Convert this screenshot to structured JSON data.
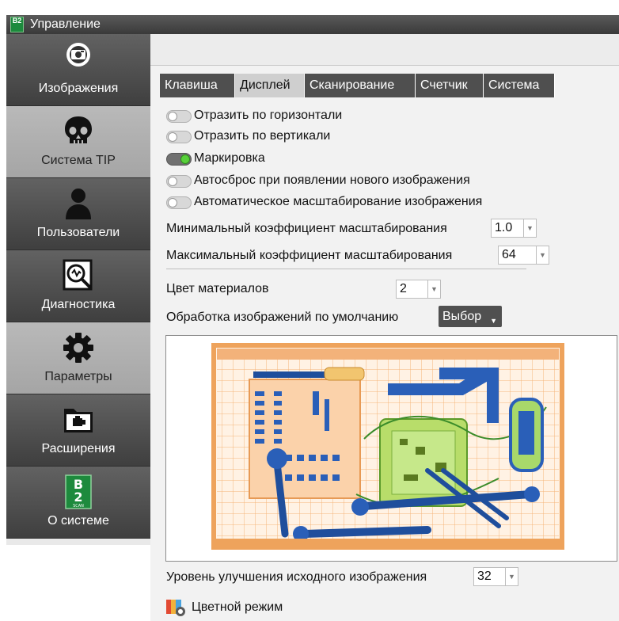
{
  "window": {
    "title": "Управление",
    "logo_text": "B2"
  },
  "sidebar": {
    "items": [
      {
        "label": "Изображения",
        "icon": "camera-icon"
      },
      {
        "label": "Система TIP",
        "icon": "skull-icon"
      },
      {
        "label": "Пользователи",
        "icon": "user-icon"
      },
      {
        "label": "Диагностика",
        "icon": "diagnostics-icon"
      },
      {
        "label": "Параметры",
        "icon": "gear-icon"
      },
      {
        "label": "Расширения",
        "icon": "folder-plugin-icon"
      },
      {
        "label": "О системе",
        "icon": "b2-scan-logo"
      }
    ],
    "logo_text": "B2",
    "logo_subtext": "SCAN"
  },
  "tabs": [
    {
      "label": "Клавиша"
    },
    {
      "label": "Дисплей"
    },
    {
      "label": "Сканирование"
    },
    {
      "label": "Счетчик"
    },
    {
      "label": "Система"
    }
  ],
  "active_tab": "Дисплей",
  "options": [
    {
      "label": "Отразить по горизонтали",
      "on": false
    },
    {
      "label": "Отразить по вертикали",
      "on": false
    },
    {
      "label": "Маркировка",
      "on": true
    },
    {
      "label": "Автосброс при появлении нового изображения",
      "on": false
    },
    {
      "label": "Автоматическое масштабирование изображения",
      "on": false
    }
  ],
  "min_scale": {
    "label": "Минимальный коэффициент масштабирования",
    "value": "1.0"
  },
  "max_scale": {
    "label": "Максимальный коэффициент масштабирования",
    "value": "64"
  },
  "material_color": {
    "label": "Цвет материалов",
    "value": "2"
  },
  "default_processing": {
    "label": "Обработка изображений по умолчанию",
    "button": "Выбор"
  },
  "enhancement": {
    "label": "Уровень улучшения исходного изображения",
    "value": "32"
  },
  "color_mode": {
    "label": "Цветной режим"
  },
  "colors": {
    "accent_green": "#58d13a",
    "nav_dark": "#4a4a4a",
    "nav_active": "#b0b0b0",
    "xray_orange": "#f0a050",
    "xray_blue": "#2a5fb8"
  }
}
